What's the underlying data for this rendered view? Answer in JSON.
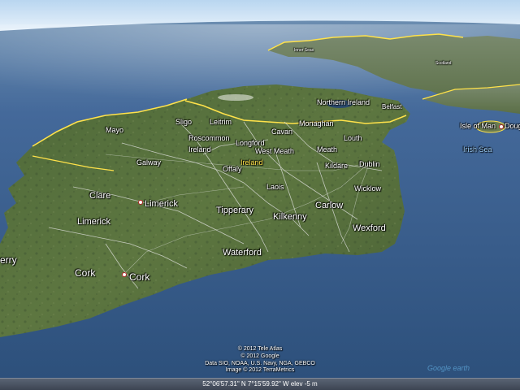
{
  "map": {
    "counties": [
      {
        "id": "mayo",
        "label": "Mayo"
      },
      {
        "id": "sligo",
        "label": "Sligo"
      },
      {
        "id": "leitrim",
        "label": "Leitrim"
      },
      {
        "id": "roscommon",
        "label": "Roscommon"
      },
      {
        "id": "galway",
        "label": "Galway"
      },
      {
        "id": "clare",
        "label": "Clare"
      },
      {
        "id": "limerick-county",
        "label": "Limerick"
      },
      {
        "id": "kerry",
        "label": "erry"
      },
      {
        "id": "cork-county",
        "label": "Cork"
      },
      {
        "id": "longford",
        "label": "Longford"
      },
      {
        "id": "westmeath",
        "label": "West Meath"
      },
      {
        "id": "cavan",
        "label": "Cavan"
      },
      {
        "id": "monaghan",
        "label": "Monaghan"
      },
      {
        "id": "louth",
        "label": "Louth"
      },
      {
        "id": "meath",
        "label": "Meath"
      },
      {
        "id": "offaly",
        "label": "Offaly"
      },
      {
        "id": "kildare",
        "label": "Kildare"
      },
      {
        "id": "laois",
        "label": "Laois"
      },
      {
        "id": "wicklow",
        "label": "Wicklow"
      },
      {
        "id": "tipperary",
        "label": "Tipperary"
      },
      {
        "id": "carlow",
        "label": "Carlow"
      },
      {
        "id": "kilkenny",
        "label": "Kilkenny"
      },
      {
        "id": "wexford",
        "label": "Wexford"
      },
      {
        "id": "waterford",
        "label": "Waterford"
      },
      {
        "id": "dublin",
        "label": "Dublin"
      }
    ],
    "cities": [
      {
        "id": "limerick-city",
        "label": "Limerick"
      },
      {
        "id": "cork-city",
        "label": "Cork"
      },
      {
        "id": "douglas",
        "label": "Dougla"
      }
    ],
    "regions": [
      {
        "id": "ireland",
        "label": "Ireland"
      },
      {
        "id": "island-ireland",
        "label": "Ireland"
      },
      {
        "id": "northern-ireland",
        "label": "Northern Ireland"
      },
      {
        "id": "belfast",
        "label": "Belfast"
      },
      {
        "id": "isle-of-man",
        "label": "Isle of Man"
      },
      {
        "id": "scotland-inner-seas",
        "label": "Inner Seas"
      },
      {
        "id": "scotland-region",
        "label": "Scotland"
      }
    ],
    "seas": [
      {
        "id": "irish-sea",
        "label": "Irish Sea"
      }
    ],
    "colors": {
      "ocean": "#2f5684",
      "land": "#56703c",
      "border": "#ffe24a",
      "roads": "#d9d9d9"
    }
  },
  "credits": {
    "line1": "© 2012 Tele Atlas",
    "line2": "© 2012 Google",
    "line3": "Data SIO, NOAA, U.S. Navy, NGA, GEBCO",
    "line4": "Image © 2012 TerraMetrics"
  },
  "status": {
    "coords": "52°06'57.31\" N    7°15'59.92\" W  elev   -5 m"
  },
  "watermark": {
    "text": "Google earth"
  }
}
